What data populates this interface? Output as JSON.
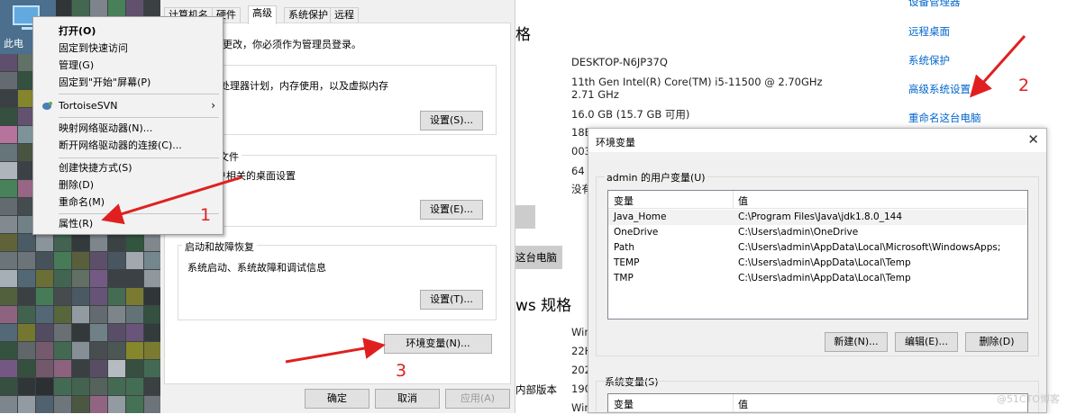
{
  "desktop": {
    "icon_label": "此电"
  },
  "context_menu": {
    "items": [
      {
        "label": "打开(O)",
        "bold": true
      },
      {
        "label": "固定到快速访问"
      },
      {
        "label": "管理(G)"
      },
      {
        "label": "固定到\"开始\"屏幕(P)"
      },
      {
        "label": "TortoiseSVN",
        "submenu": true
      },
      {
        "label": "映射网络驱动器(N)..."
      },
      {
        "label": "断开网络驱动器的连接(C)..."
      },
      {
        "label": "创建快捷方式(S)"
      },
      {
        "label": "删除(D)"
      },
      {
        "label": "重命名(M)"
      },
      {
        "label": "属性(R)"
      }
    ],
    "submenu_arrow": "›"
  },
  "system_properties": {
    "tabs": [
      "计算机名",
      "硬件",
      "高级",
      "系统保护",
      "远程"
    ],
    "active_tab": "高级",
    "admin_note": "数更改，你必须作为管理员登录。",
    "performance": {
      "desc": "处理器计划，内存使用，以及虚拟内存",
      "button": "设置(S)..."
    },
    "profiles": {
      "title": "文件",
      "desc": "户相关的桌面设置",
      "button": "设置(E)..."
    },
    "startup": {
      "title": "启动和故障恢复",
      "desc": "系统启动、系统故障和调试信息",
      "button": "设置(T)..."
    },
    "env_button": "环境变量(N)...",
    "ok": "确定",
    "cancel": "取消",
    "apply": "应用(A)"
  },
  "about": {
    "heading_top": "格",
    "specs": [
      "DESKTOP-N6JP37Q",
      "11th Gen Intel(R) Core(TM) i5-11500 @ 2.70GHz",
      "2.71 GHz",
      "16.0 GB (15.7 GB 可用)",
      "18BF",
      "0034",
      "64 位",
      "没有"
    ],
    "rename_button": "这台电脑",
    "heading_mid": "ws 规格",
    "win_vals": [
      "Win",
      "22H",
      "2024",
      "1904",
      "Win"
    ],
    "internal_version_key": "内部版本",
    "links": [
      "设备管理器",
      "远程桌面",
      "系统保护",
      "高级系统设置",
      "重命名这台电脑"
    ]
  },
  "env_dialog": {
    "title": "环境变量",
    "close": "✕",
    "user_group_title": "admin 的用户变量(U)",
    "col_var": "变量",
    "col_val": "值",
    "user_vars": [
      {
        "name": "Java_Home",
        "value": "C:\\Program Files\\Java\\jdk1.8.0_144"
      },
      {
        "name": "OneDrive",
        "value": "C:\\Users\\admin\\OneDrive"
      },
      {
        "name": "Path",
        "value": "C:\\Users\\admin\\AppData\\Local\\Microsoft\\WindowsApps;"
      },
      {
        "name": "TEMP",
        "value": "C:\\Users\\admin\\AppData\\Local\\Temp"
      },
      {
        "name": "TMP",
        "value": "C:\\Users\\admin\\AppData\\Local\\Temp"
      }
    ],
    "new_btn": "新建(N)...",
    "edit_btn": "编辑(E)...",
    "delete_btn": "删除(D)",
    "sys_group_title": "系统变量(S)"
  },
  "annotations": {
    "n1": "1",
    "n2": "2",
    "n3": "3",
    "watermark": "@51CTO博客"
  },
  "colors": {
    "arrow": "#e02020",
    "link": "#0066cc"
  }
}
